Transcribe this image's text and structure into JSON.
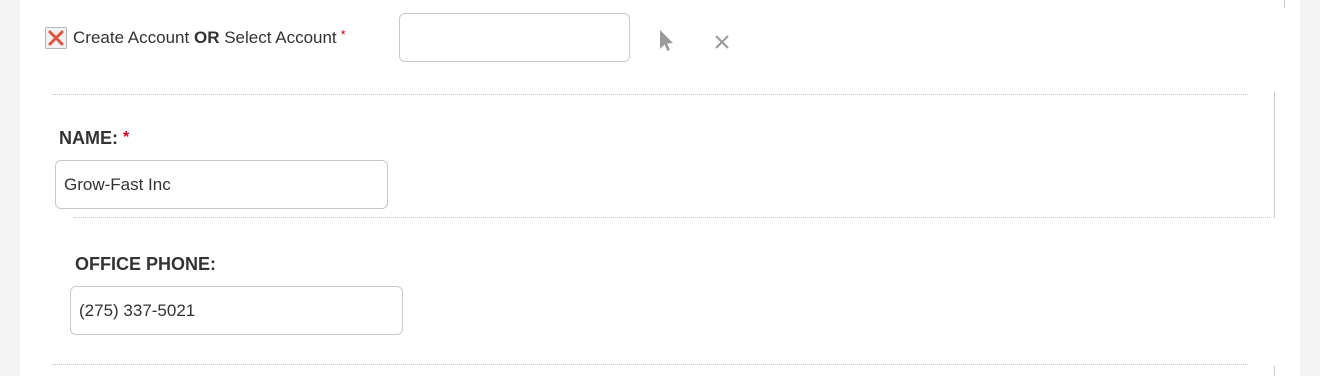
{
  "account_row": {
    "checkbox_checked": true,
    "label_part1": "Create Account ",
    "label_or": "OR",
    "label_part2": " Select Account",
    "required_mark": "*",
    "select_account_value": "",
    "icons": {
      "select": "arrow-pointer-icon",
      "clear": "close-icon"
    }
  },
  "name_field": {
    "label": "NAME:",
    "required_mark": "*",
    "value": "Grow-Fast Inc"
  },
  "office_phone_field": {
    "label": "OFFICE PHONE:",
    "value": "(275) 337-5021"
  },
  "colors": {
    "required": "#d0021b",
    "checkbox_x": "#e0533f"
  }
}
